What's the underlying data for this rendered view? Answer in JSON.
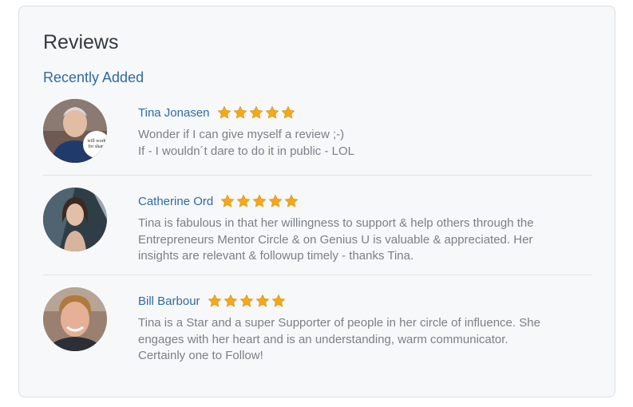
{
  "reviews": {
    "title": "Reviews",
    "subtitle": "Recently Added",
    "star_color": "#f2a91a",
    "items": [
      {
        "name": "Tina Jonasen",
        "rating": 5,
        "text": [
          "Wonder if I can give myself a review ;-)",
          "If - I wouldn´t dare to do it in public - LOL"
        ],
        "avatar_badge": [
          "will work",
          "for share"
        ]
      },
      {
        "name": "Catherine Ord",
        "rating": 5,
        "text": [
          "Tina is fabulous in that her willingness to support & help others through the",
          "Entrepreneurs Mentor Circle & on Genius U is valuable & appreciated. Her",
          "insights are relevant & followup timely - thanks Tina."
        ]
      },
      {
        "name": "Bill Barbour",
        "rating": 5,
        "text": [
          "Tina is a Star and a super Supporter of people in her circle of influence. She",
          "engages with her heart and is an understanding, warm communicator.",
          "Certainly one to Follow!"
        ]
      }
    ]
  }
}
